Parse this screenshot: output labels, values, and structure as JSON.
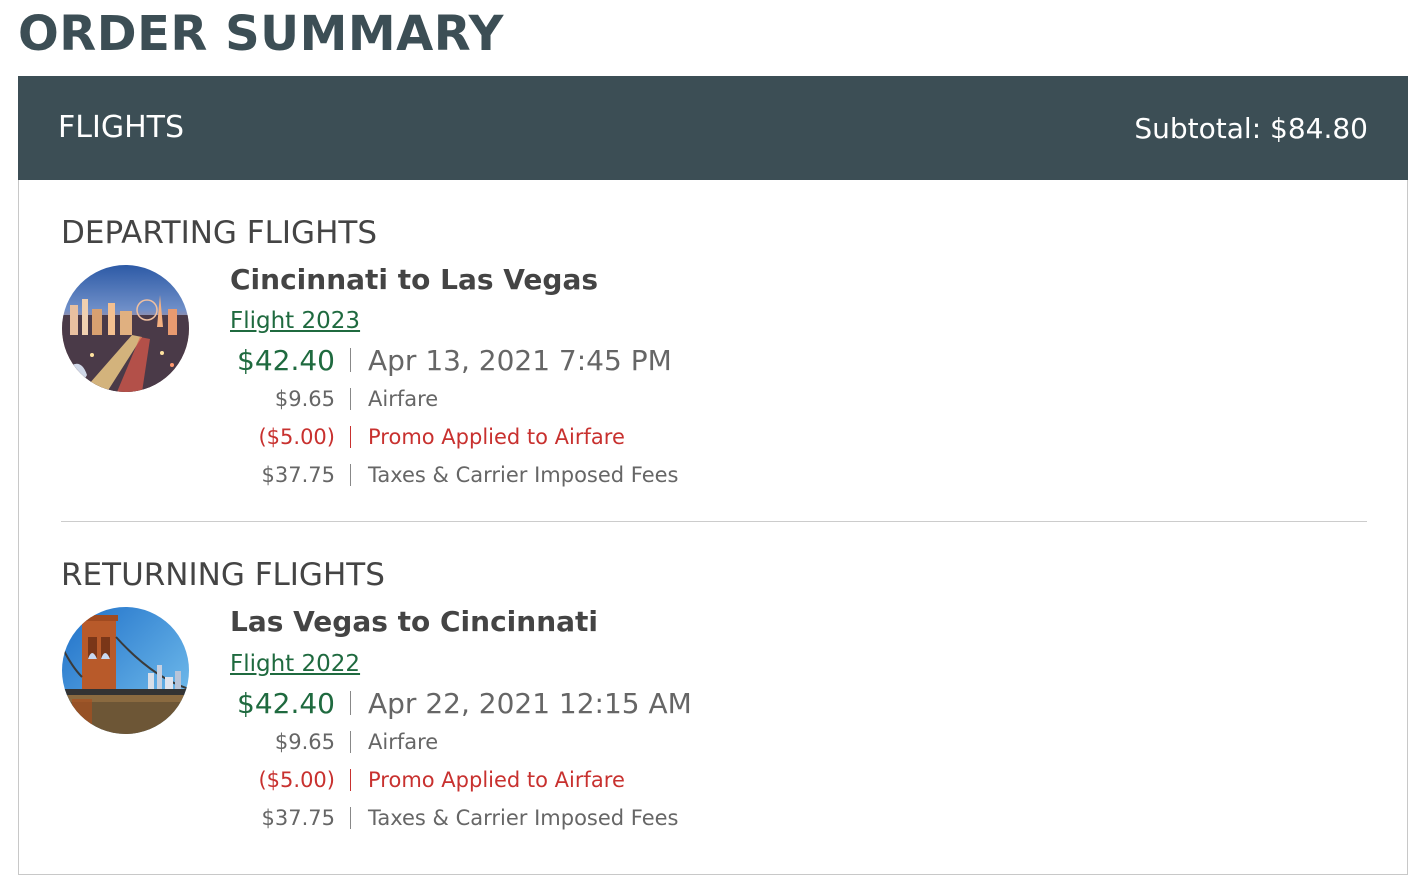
{
  "page_title": "ORDER SUMMARY",
  "header": {
    "title": "FLIGHTS",
    "subtotal": "Subtotal: $84.80"
  },
  "sections": [
    {
      "title": "DEPARTING FLIGHTS",
      "route": "Cincinnati to Las Vegas",
      "flight_link": "Flight 2023",
      "total": "$42.40",
      "datetime": "Apr 13, 2021 7:45 PM",
      "lines": [
        {
          "amount": "$9.65",
          "label": "Airfare"
        },
        {
          "amount": "($5.00)",
          "label": "Promo Applied to Airfare"
        },
        {
          "amount": "$37.75",
          "label": "Taxes & Carrier Imposed Fees"
        }
      ],
      "image": "las-vegas-skyline"
    },
    {
      "title": "RETURNING FLIGHTS",
      "route": "Las Vegas to Cincinnati",
      "flight_link": "Flight 2022",
      "total": "$42.40",
      "datetime": "Apr 22, 2021 12:15 AM",
      "lines": [
        {
          "amount": "$9.65",
          "label": "Airfare"
        },
        {
          "amount": "($5.00)",
          "label": "Promo Applied to Airfare"
        },
        {
          "amount": "$37.75",
          "label": "Taxes & Carrier Imposed Fees"
        }
      ],
      "image": "cincinnati-bridge"
    }
  ],
  "colors": {
    "header_bg": "#3c4e55",
    "price_green": "#1f6a3f",
    "promo_red": "#c8312f"
  }
}
